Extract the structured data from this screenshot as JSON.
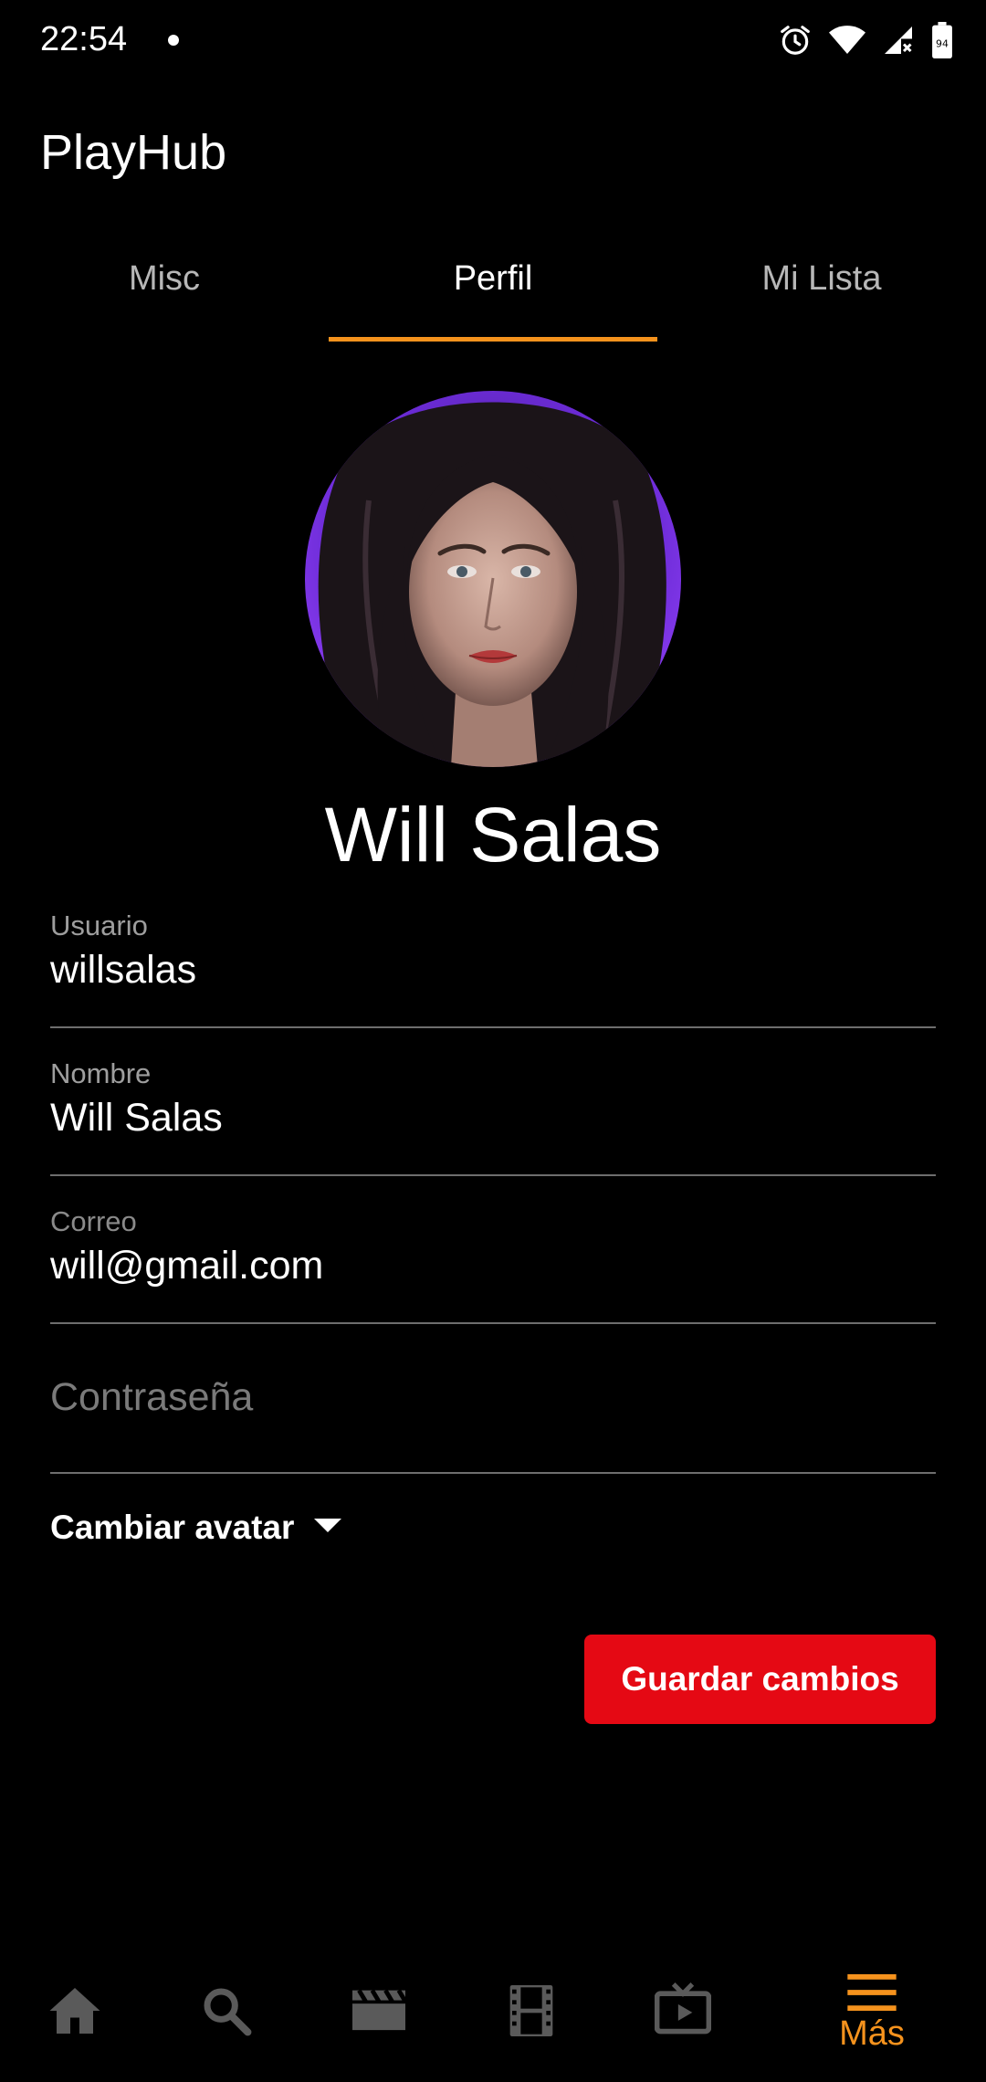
{
  "status_bar": {
    "time": "22:54",
    "battery": "94",
    "icons": [
      "alarm-icon",
      "wifi-icon",
      "signal-icon",
      "battery-icon"
    ]
  },
  "app": {
    "title": "PlayHub"
  },
  "tabs": [
    {
      "label": "Misc",
      "active": false
    },
    {
      "label": "Perfil",
      "active": true
    },
    {
      "label": "Mi Lista",
      "active": false
    }
  ],
  "profile": {
    "display_name": "Will Salas"
  },
  "form": {
    "username": {
      "label": "Usuario",
      "value": "willsalas"
    },
    "name": {
      "label": "Nombre",
      "value": "Will Salas"
    },
    "email": {
      "label": "Correo",
      "value": "will@gmail.com"
    },
    "password": {
      "placeholder": "Contraseña",
      "value": ""
    }
  },
  "change_avatar": {
    "label": "Cambiar avatar"
  },
  "save_button": {
    "label": "Guardar cambios"
  },
  "bottom_nav": {
    "items": [
      {
        "icon": "home-icon"
      },
      {
        "icon": "search-icon"
      },
      {
        "icon": "clapperboard-icon"
      },
      {
        "icon": "film-strip-icon"
      },
      {
        "icon": "tv-icon"
      },
      {
        "icon": "menu-icon",
        "label": "Más",
        "active": true
      }
    ]
  },
  "colors": {
    "background": "#000000",
    "accent": "#f5921d",
    "button": "#e50914",
    "divider": "#6e6e6e",
    "nav_inactive": "#5a5a5a"
  }
}
